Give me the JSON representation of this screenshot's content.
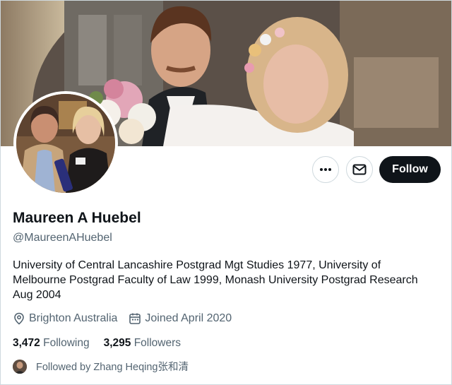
{
  "profile": {
    "name": "Maureen A Huebel",
    "handle": "@MaureenAHuebel",
    "bio": "University of Central Lancashire Postgrad Mgt Studies 1977, University of Melbourne Postgrad Faculty of Law 1999, Monash University Postgrad Research Aug 2004",
    "location": "Brighton Australia",
    "joined": "Joined April 2020"
  },
  "stats": {
    "following_count": "3,472",
    "following_label": "Following",
    "followers_count": "3,295",
    "followers_label": "Followers"
  },
  "followed_by": "Followed by Zhang Heqing张和清",
  "actions": {
    "more_icon": "more-icon",
    "message_icon": "envelope-icon",
    "follow_label": "Follow"
  },
  "icons": {
    "location": "location-pin-icon",
    "calendar": "calendar-icon"
  },
  "colors": {
    "primary_text": "#0f1419",
    "secondary_text": "#536471",
    "follow_button_bg": "#0f1419",
    "border": "#cfd9de"
  }
}
